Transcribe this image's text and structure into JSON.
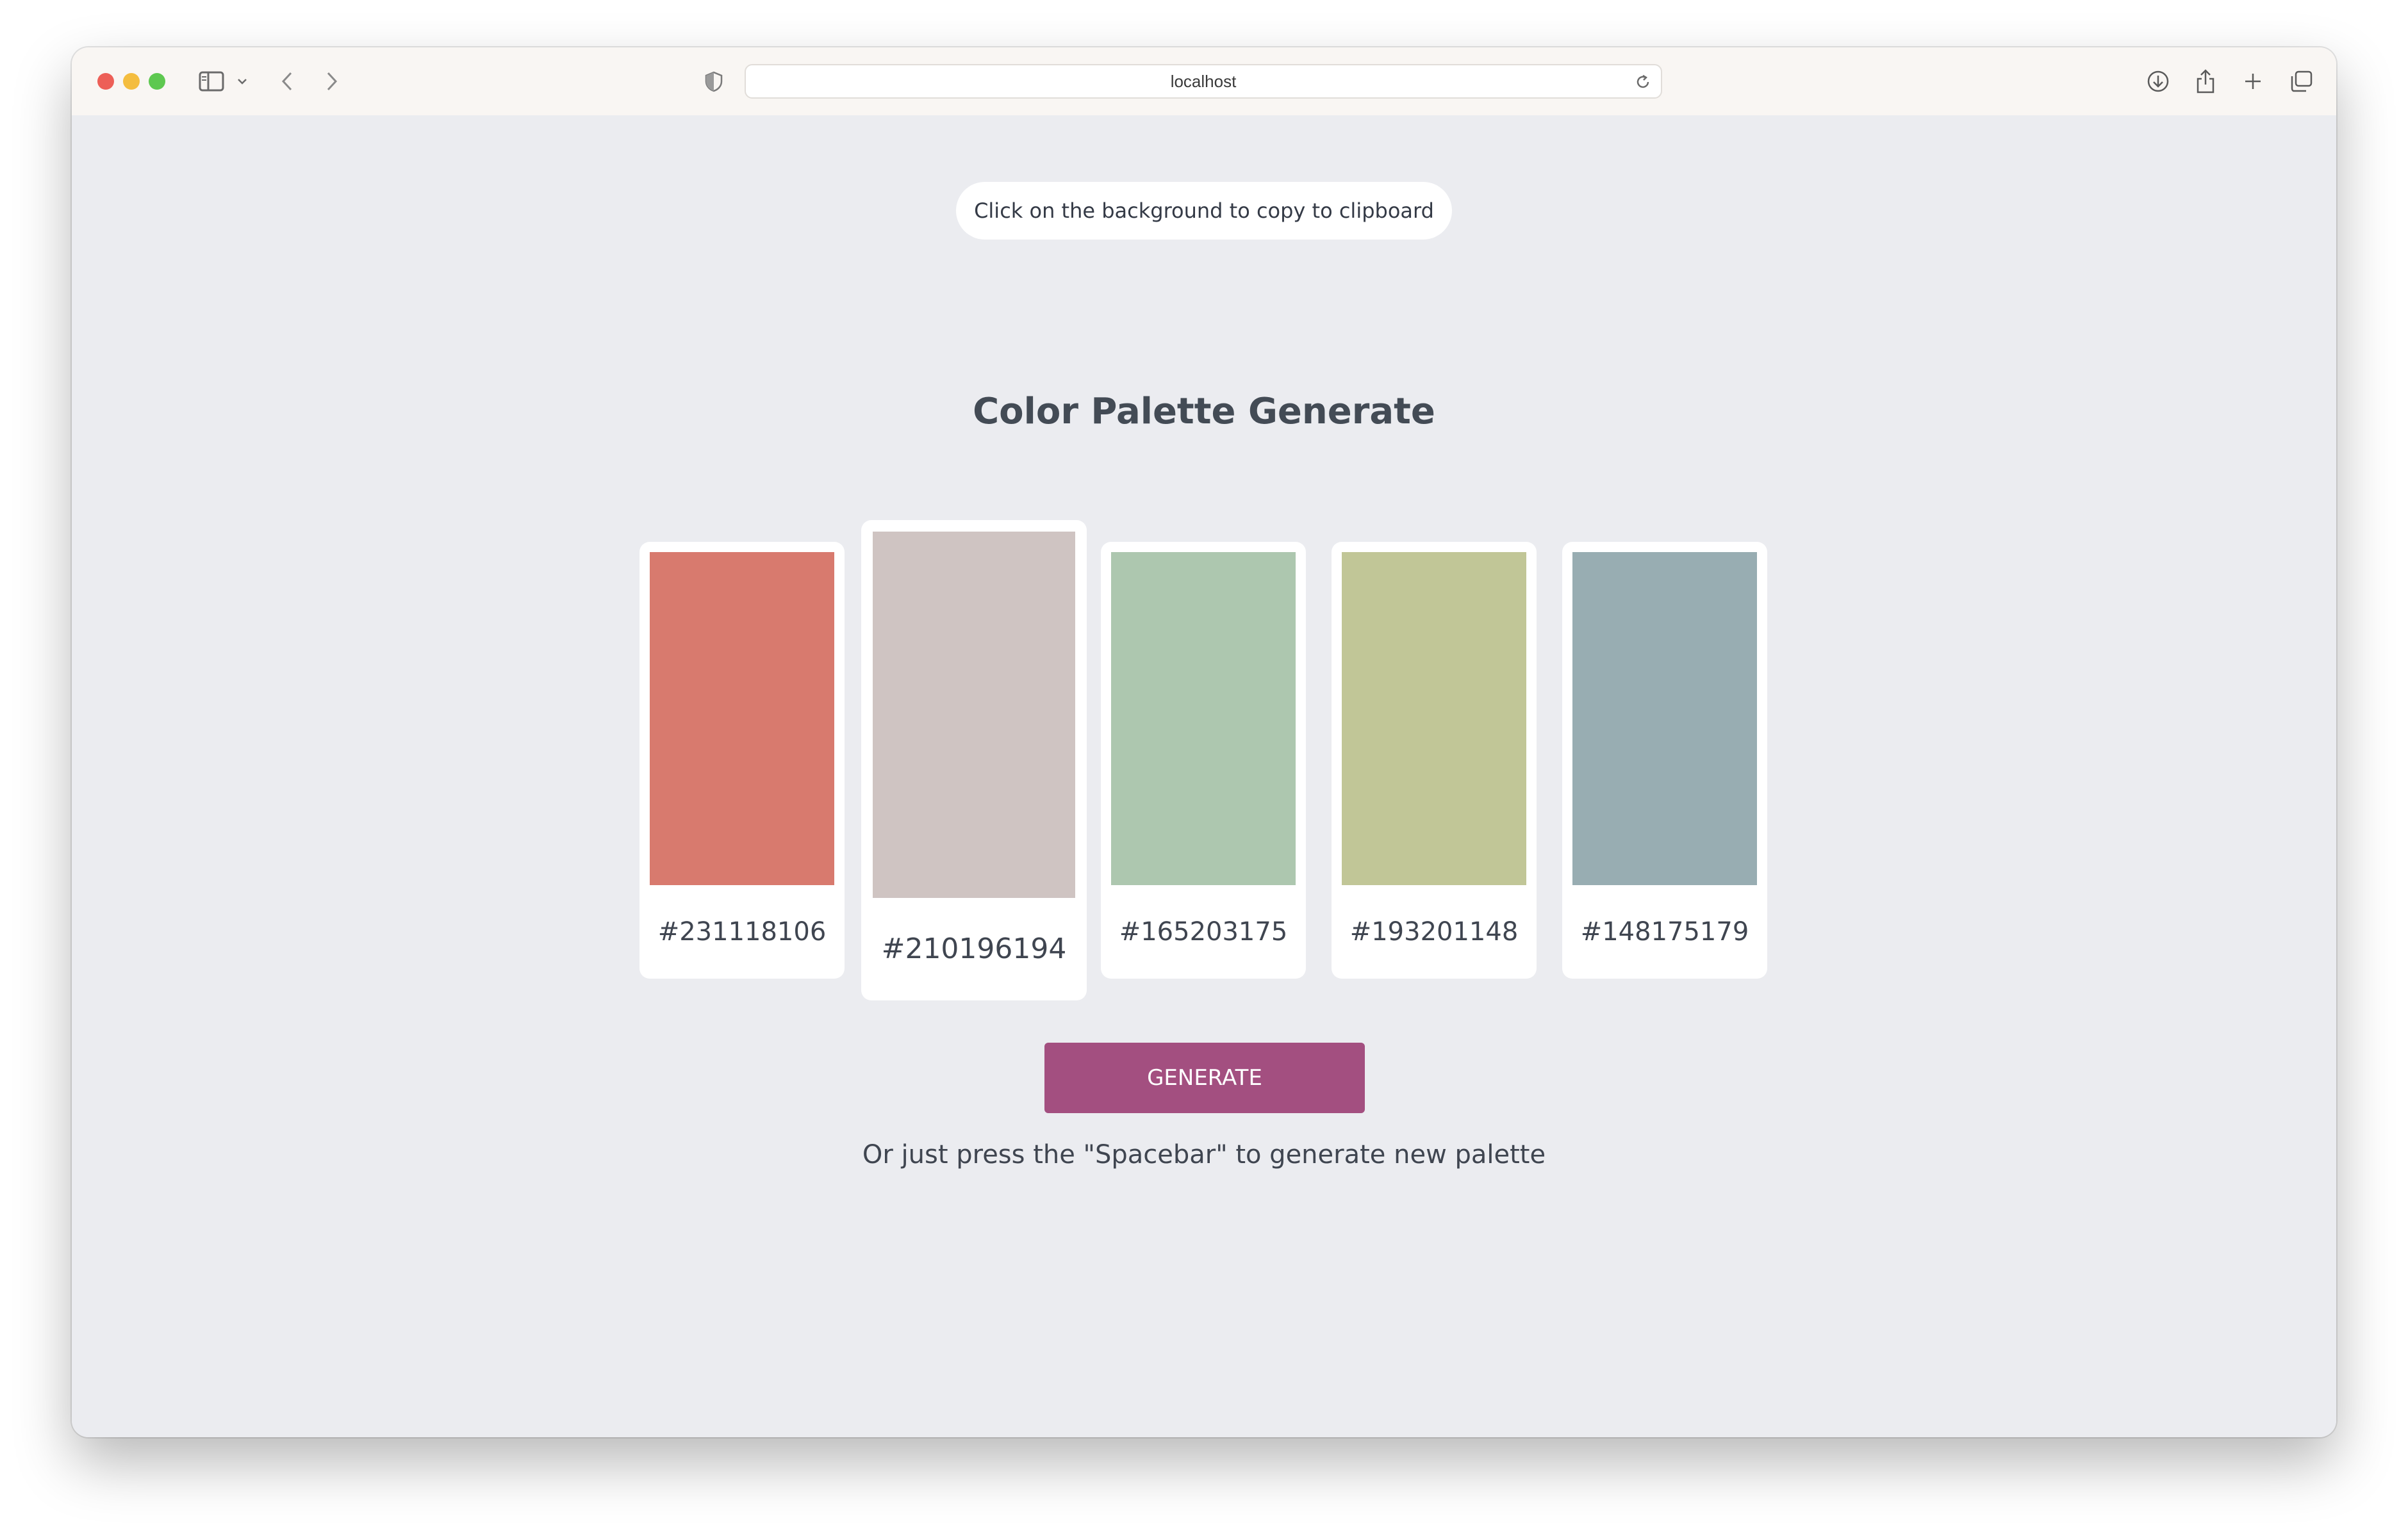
{
  "browser": {
    "url": "localhost",
    "icons": [
      "sidebar-icon",
      "chevron-down-icon",
      "back-arrow-icon",
      "forward-arrow-icon",
      "privacy-shield-icon",
      "reload-icon",
      "download-icon",
      "share-icon",
      "new-tab-plus-icon",
      "tab-overview-icon"
    ]
  },
  "page": {
    "clipboard_hint": "Click on the background to copy to clipboard",
    "title": "Color Palette Generate",
    "generate_label": "GENERATE",
    "spacebar_hint": "Or just press the \"Spacebar\" to generate new palette",
    "button_color": "#a34f80",
    "background_color": "#ebecf0"
  },
  "palette": [
    {
      "label": "#231118106",
      "color": "#d87a6e",
      "active": false
    },
    {
      "label": "#210196194",
      "color": "#cfc4c2",
      "active": true
    },
    {
      "label": "#165203175",
      "color": "#adc7af",
      "active": false
    },
    {
      "label": "#193201148",
      "color": "#c1c697",
      "active": false
    },
    {
      "label": "#148175179",
      "color": "#98adb2",
      "active": false
    }
  ]
}
